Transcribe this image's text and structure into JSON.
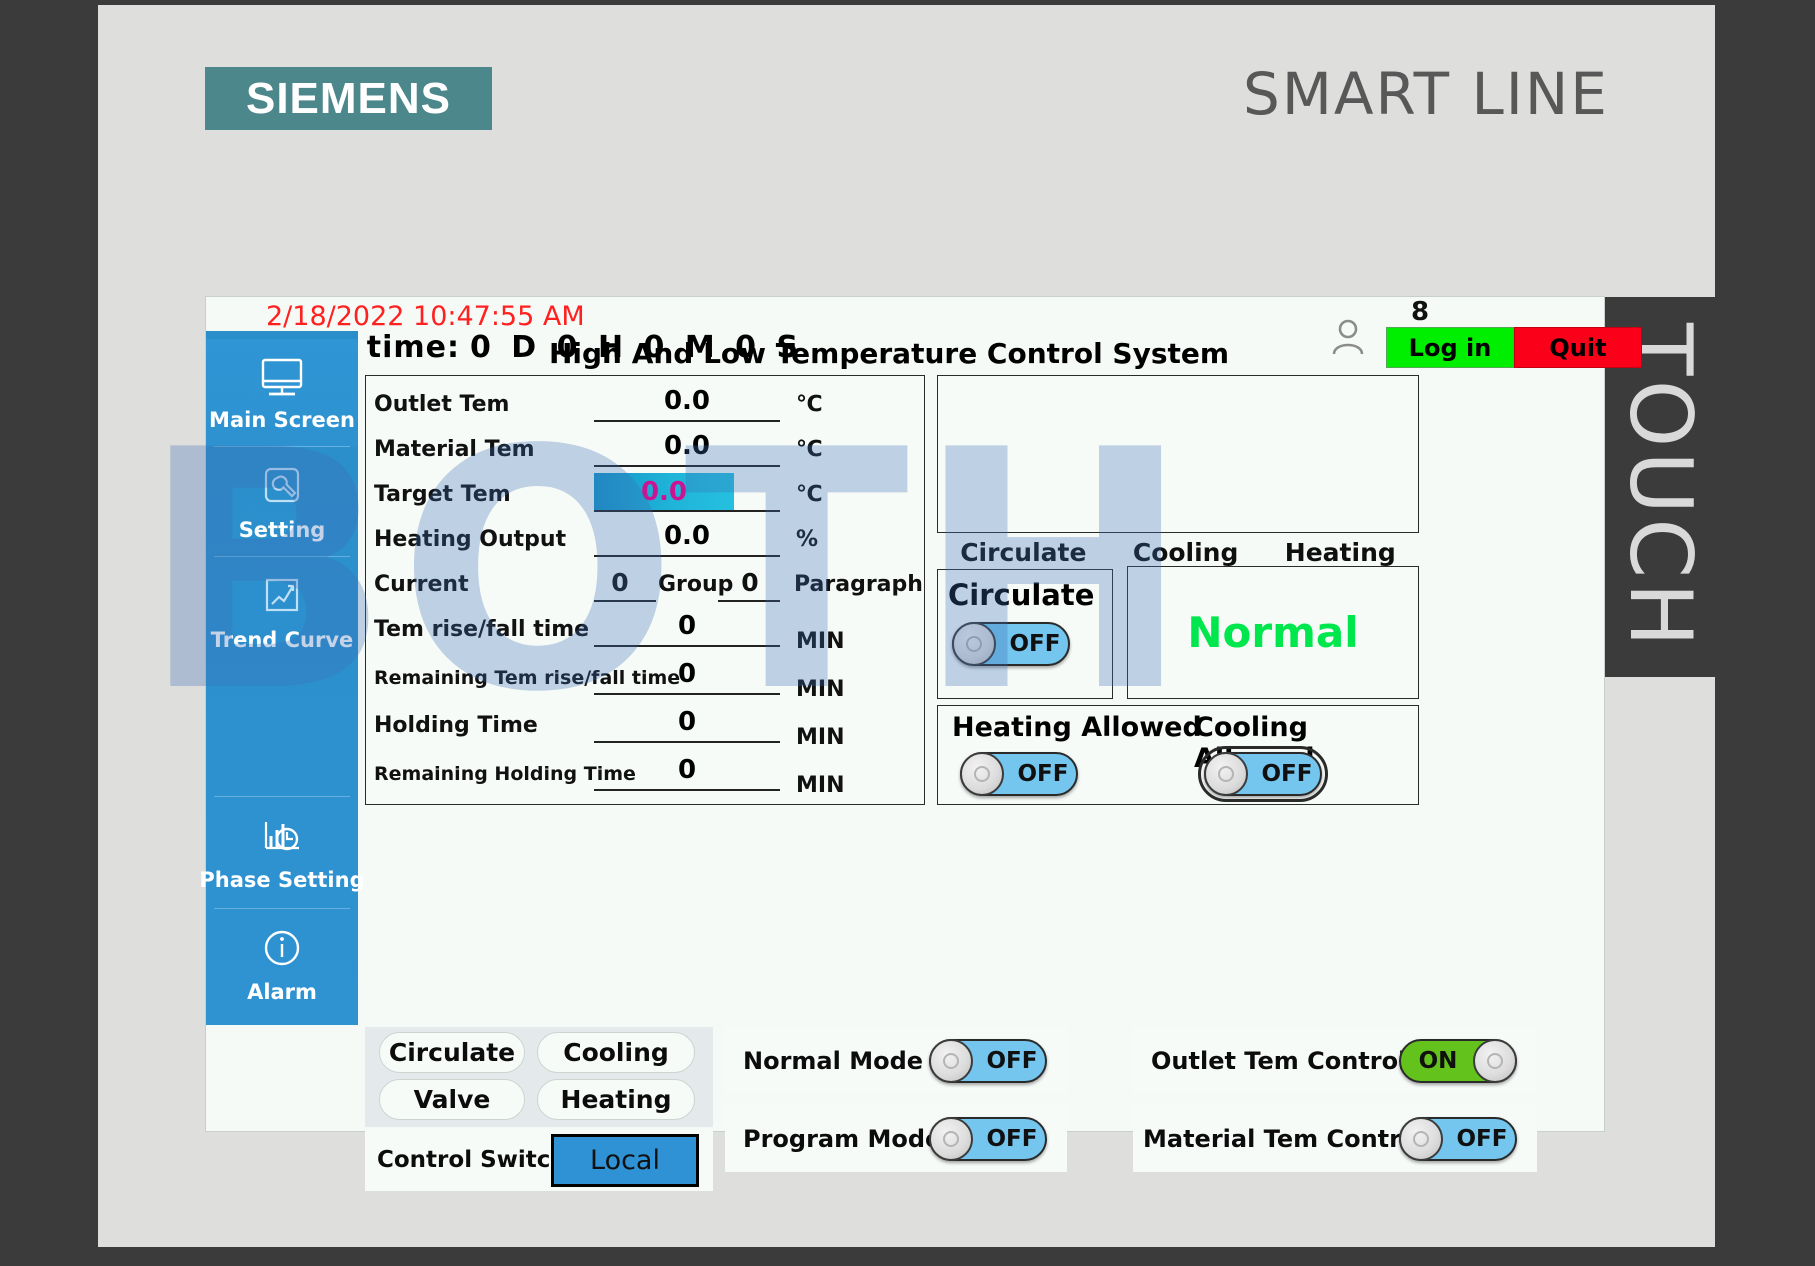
{
  "branding": {
    "logo": "SIEMENS",
    "product_line": "SMART LINE",
    "side_band": "TOUCH"
  },
  "watermark": "BOTH",
  "status_bar": {
    "datetime": "2/18/2022 10:47:55 AM",
    "running_time_label": "Running time:",
    "running_time_value": "0 D 0  H  0  M  0  S",
    "user_count": "8",
    "user_icon": "user-icon",
    "login_label": "Log in",
    "quit_label": "Quit"
  },
  "sidebar": {
    "items": [
      {
        "label": "Main Screen",
        "icon": "monitor-icon"
      },
      {
        "label": "Setting",
        "icon": "wrench-icon"
      },
      {
        "label": "Trend Curve",
        "icon": "line-chart-icon"
      },
      {
        "label": "Phase Setting",
        "icon": "bar-chart-clock-icon"
      },
      {
        "label": "Alarm",
        "icon": "info-circle-icon"
      }
    ]
  },
  "main": {
    "title": "High And Low Temperature Control System",
    "rows": [
      {
        "label": "Outlet Tem",
        "value": "0.0",
        "unit": "℃",
        "highlight": false
      },
      {
        "label": "Material Tem",
        "value": "0.0",
        "unit": "℃",
        "highlight": false
      },
      {
        "label": "Target Tem",
        "value": "0.0",
        "unit": "℃",
        "highlight": true
      },
      {
        "label": "Heating Output",
        "value": "0.0",
        "unit": "%",
        "highlight": false
      },
      {
        "label": "Tem rise/fall time",
        "value": "0",
        "unit": "MIN",
        "highlight": false
      },
      {
        "label": "Remaining Tem rise/fall time",
        "value": "0",
        "unit": "MIN",
        "highlight": false
      },
      {
        "label": "Holding Time",
        "value": "0",
        "unit": "MIN",
        "highlight": false
      },
      {
        "label": "Remaining Holding Time",
        "value": "0",
        "unit": "MIN",
        "highlight": false
      }
    ],
    "current_row": {
      "label": "Current",
      "group_value": "0",
      "group_label": "Group",
      "paragraph_value": "0",
      "paragraph_label": "Paragraph"
    }
  },
  "indicators": {
    "labels": [
      "Circulate",
      "Cooling",
      "Heating"
    ]
  },
  "circulate_panel": {
    "title": "Circulate",
    "toggle_state": "OFF"
  },
  "status_panel": {
    "text": "Normal",
    "color": "#00e64d"
  },
  "allow_panel": {
    "heating": {
      "label": "Heating Allowed",
      "toggle_state": "OFF"
    },
    "cooling": {
      "label": "Cooling Allowed",
      "toggle_state": "OFF"
    }
  },
  "bottom": {
    "pills": [
      "Circulate",
      "Cooling",
      "Valve",
      "Heating"
    ],
    "control_switch": {
      "label": "Control Switch",
      "selected": "Local"
    },
    "modes": [
      {
        "label": "Normal Mode",
        "state": "OFF",
        "on": false
      },
      {
        "label": "Program Mode",
        "state": "OFF",
        "on": false
      },
      {
        "label": "Outlet Tem Control",
        "state": "ON",
        "on": true
      },
      {
        "label": "Material Tem Control",
        "state": "OFF",
        "on": false
      }
    ]
  }
}
